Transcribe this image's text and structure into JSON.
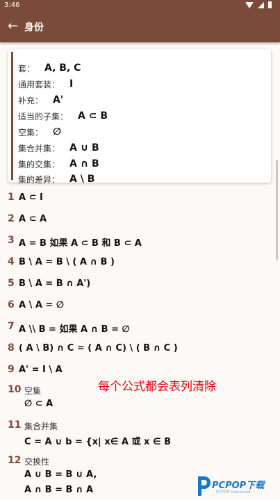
{
  "status_bar": {
    "time": "3:46"
  },
  "app_bar": {
    "title": "身份",
    "back_label": "←"
  },
  "definitions": [
    {
      "label": "套：",
      "symbol": "A, B, C"
    },
    {
      "label": "通用套装：",
      "symbol": "I"
    },
    {
      "label": "补充：",
      "symbol": "A'"
    },
    {
      "label": "适当的子集：",
      "symbol": "A ⊂ B"
    },
    {
      "label": "空集：",
      "symbol": "∅"
    },
    {
      "label": "集合并集：",
      "symbol": "A ∪ B"
    },
    {
      "label": "集的交集：",
      "symbol": "A ∩ B"
    },
    {
      "label": "集的差异：",
      "symbol": "A \\ B"
    }
  ],
  "identities": [
    {
      "num": "1",
      "formula": "A ⊂ I"
    },
    {
      "num": "2",
      "formula": "A ⊂ A"
    },
    {
      "num": "3",
      "formula": "A = B 如果 A ⊂ B 和 B ⊂ A"
    },
    {
      "num": "4",
      "formula": "B \\ A = B \\ ( A ∩ B )"
    },
    {
      "num": "5",
      "formula": "B \\ A = B ∩ A')"
    },
    {
      "num": "6",
      "formula": "A \\ A = ∅"
    },
    {
      "num": "7",
      "formula": "A \\\\ B =  如果 A ∩ B = ∅"
    },
    {
      "num": "8",
      "formula": "( A \\ B) ∩ C = ( A ∩ C) \\ ( B ∩ C )"
    },
    {
      "num": "9",
      "formula": "A' = I \\ A"
    }
  ],
  "named_identities": [
    {
      "num": "10",
      "caption": "空集",
      "lines": [
        "∅ ⊂ A"
      ]
    },
    {
      "num": "11",
      "caption": "集合并集",
      "lines": [
        "C = A ∪ b = {x| x∈ A 或 x ∈ B"
      ]
    },
    {
      "num": "12",
      "caption": "交换性",
      "lines": [
        "A ∪ B = B ∪ A,",
        "A ∩ B = B ∩ A"
      ]
    }
  ],
  "overlay_text": "每个公式都会表列清除",
  "watermark": {
    "brand": "PCPOP",
    "suffix": "下载",
    "sub": "PCPOP Download"
  },
  "colors": {
    "primary": "#7a4b3b",
    "overlay": "#e60012",
    "watermark": "#1679c7"
  },
  "icons": [
    "wifi-icon",
    "signal-icon",
    "battery-icon",
    "back-arrow-icon"
  ]
}
